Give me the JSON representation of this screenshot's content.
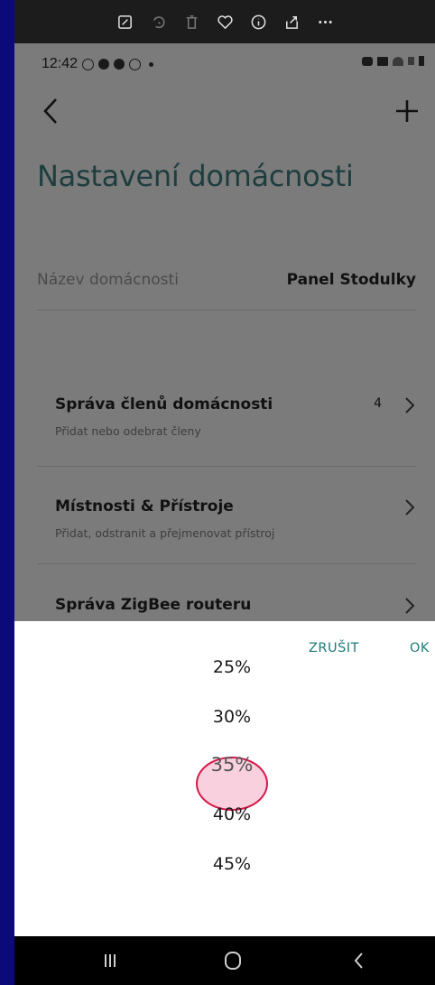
{
  "status_bar": {
    "time": "12:42"
  },
  "header": {
    "title": "Nastavení domácnosti"
  },
  "household": {
    "name_label": "Název domácnosti",
    "name_value": "Panel Stodulky"
  },
  "menu": [
    {
      "title": "Správa členů domácnosti",
      "subtitle": "Přidat nebo odebrat členy",
      "count": "4"
    },
    {
      "title": "Místnosti & Přístroje",
      "subtitle": "Přidat, odstranit a přejmenovat přístroj",
      "count": ""
    },
    {
      "title": "Správa ZigBee routeru",
      "subtitle": "",
      "count": ""
    }
  ],
  "picker": {
    "cancel_label": "ZRUŠIT",
    "ok_label": "OK",
    "options": [
      "25%",
      "30%",
      "35%",
      "40%",
      "45%"
    ],
    "selected": "35%",
    "highlight_color": "#d3194c"
  },
  "colors": {
    "accent": "#1f7a7a",
    "title": "#1f3d3e",
    "frame": "#0a0a7a"
  }
}
